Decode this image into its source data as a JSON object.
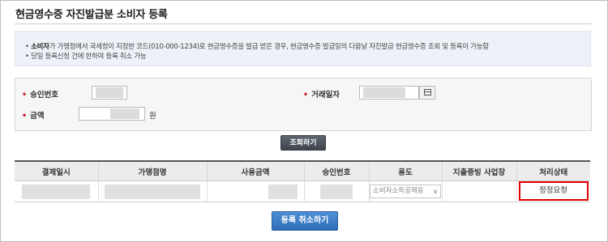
{
  "page": {
    "title": "현금영수증 자진발급분 소비자 등록"
  },
  "notice": {
    "line1_bold": "소비자",
    "line1_rest": "가 가맹점에서 국세청이 지정한 코드(010-000-1234)로 현금영수증을 발급 받은 경우, 현금영수증 발급일의 다음날 자진발급 현금영수증 조회 및 등록이 가능함",
    "line2": "당일 등록신청 건에 한하여 등록 취소 가능"
  },
  "form": {
    "approval_label": "승인번호",
    "trade_date_label": "거래일자",
    "amount_label": "금액",
    "amount_unit": "원"
  },
  "buttons": {
    "search": "조회하기",
    "cancel": "등록 취소하기"
  },
  "table": {
    "headers": [
      "결제일시",
      "가맹점명",
      "사용금액",
      "승인번호",
      "용도",
      "지출증빙 사업장",
      "처리상태"
    ],
    "rows": [
      {
        "usage": "소비자소득공제용",
        "status": "정정요청"
      }
    ]
  },
  "colors": {
    "required_star": "#c8162a",
    "highlight_border": "#e00000",
    "primary_button": "#2f6db8"
  }
}
